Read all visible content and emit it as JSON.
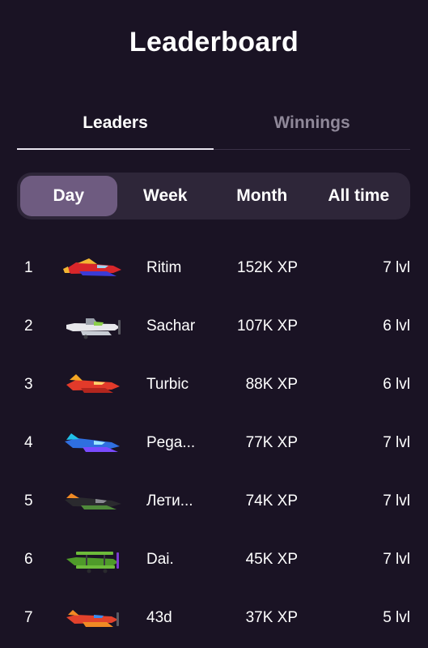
{
  "header": {
    "title": "Leaderboard"
  },
  "tabs": [
    {
      "label": "Leaders",
      "active": true
    },
    {
      "label": "Winnings",
      "active": false
    }
  ],
  "periods": [
    {
      "label": "Day",
      "active": true
    },
    {
      "label": "Week",
      "active": false
    },
    {
      "label": "Month",
      "active": false
    },
    {
      "label": "All time",
      "active": false
    }
  ],
  "leaders": [
    {
      "rank": "1",
      "name": "Ritim",
      "xp": "152K XP",
      "level": "7 lvl",
      "avatar": "red-jet-plane-icon",
      "colors": {
        "body": "#d8262a",
        "accent": "#f2b633",
        "wing": "#3b3bd6"
      }
    },
    {
      "rank": "2",
      "name": "Sachar",
      "xp": "107K XP",
      "level": "6 lvl",
      "avatar": "white-prop-plane-icon",
      "colors": {
        "body": "#e8e8ec",
        "accent": "#8ccf4a",
        "wing": "#9aa0aa"
      }
    },
    {
      "rank": "3",
      "name": "Turbic",
      "xp": "88K XP",
      "level": "6 lvl",
      "avatar": "red-jet-plane-icon",
      "colors": {
        "body": "#e23a2a",
        "accent": "#f5a623",
        "wing": "#b3261e"
      }
    },
    {
      "rank": "4",
      "name": "Pega...",
      "xp": "77K XP",
      "level": "7 lvl",
      "avatar": "blue-jet-plane-icon",
      "colors": {
        "body": "#2f6fe0",
        "accent": "#7a4bff",
        "wing": "#20c0e8"
      }
    },
    {
      "rank": "5",
      "name": "Лети...",
      "xp": "74K XP",
      "level": "7 lvl",
      "avatar": "black-jet-plane-icon",
      "colors": {
        "body": "#2a2a2e",
        "accent": "#f08a24",
        "wing": "#4f8a3a"
      }
    },
    {
      "rank": "6",
      "name": "Dai.",
      "xp": "45K XP",
      "level": "7 lvl",
      "avatar": "green-biplane-icon",
      "colors": {
        "body": "#4f9a2a",
        "accent": "#7a3ad0",
        "wing": "#6dbb3b"
      }
    },
    {
      "rank": "7",
      "name": "43d",
      "xp": "37K XP",
      "level": "5 lvl",
      "avatar": "red-prop-plane-icon",
      "colors": {
        "body": "#e2422c",
        "accent": "#3b8cf0",
        "wing": "#f08a24"
      }
    }
  ]
}
